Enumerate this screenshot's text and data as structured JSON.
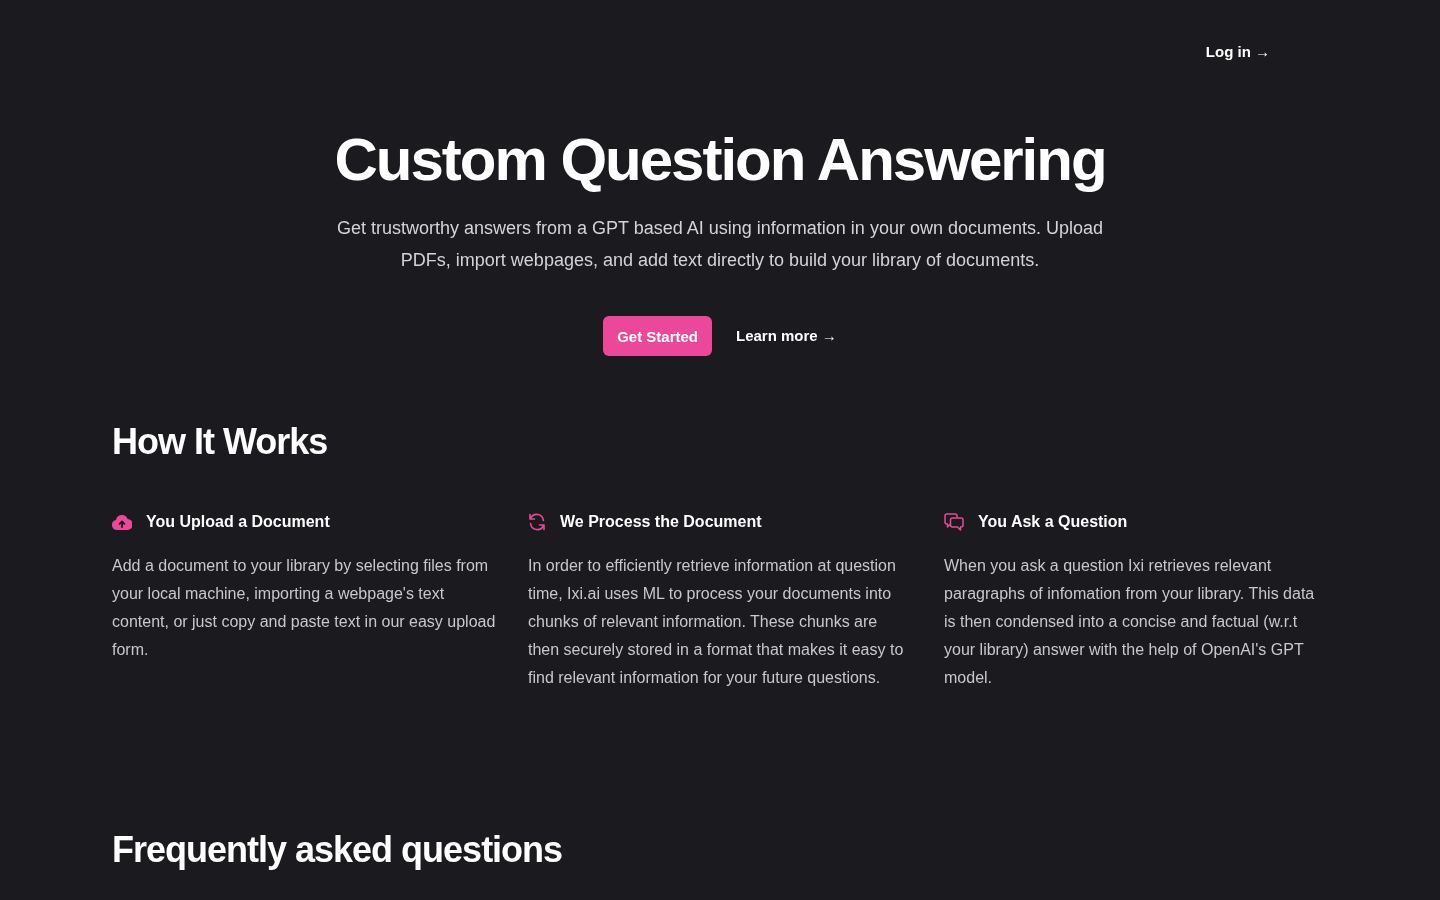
{
  "nav": {
    "login_link": "Log in →"
  },
  "hero": {
    "title": "Custom Question Answering",
    "subtitle": "Get trustworthy answers from a GPT based AI using information in your own documents. Upload PDFs, import webpages, and add text directly to build your library of documents.",
    "primary_button": "Get Started",
    "secondary_link": "Learn more →"
  },
  "how_it_works": {
    "heading": "How It Works",
    "steps": [
      {
        "title": "You Upload a Document",
        "text": "Add a document to your library by selecting files from your local machine, importing a webpage's text content, or just copy and paste text in our easy upload form."
      },
      {
        "title": "We Process the Document",
        "text": "In order to efficiently retrieve information at question time, Ixi.ai uses ML to process your documents into chunks of relevant information. These chunks are then securely stored in a format that makes it easy to find relevant information for your future questions."
      },
      {
        "title": "You Ask a Question",
        "text": "When you ask a question Ixi retrieves relevant paragraphs of infomation from your library. This data is then condensed into a concise and factual (w.r.t your library) answer with the help of OpenAI's GPT model."
      }
    ]
  },
  "faq": {
    "heading": "Frequently asked questions"
  }
}
